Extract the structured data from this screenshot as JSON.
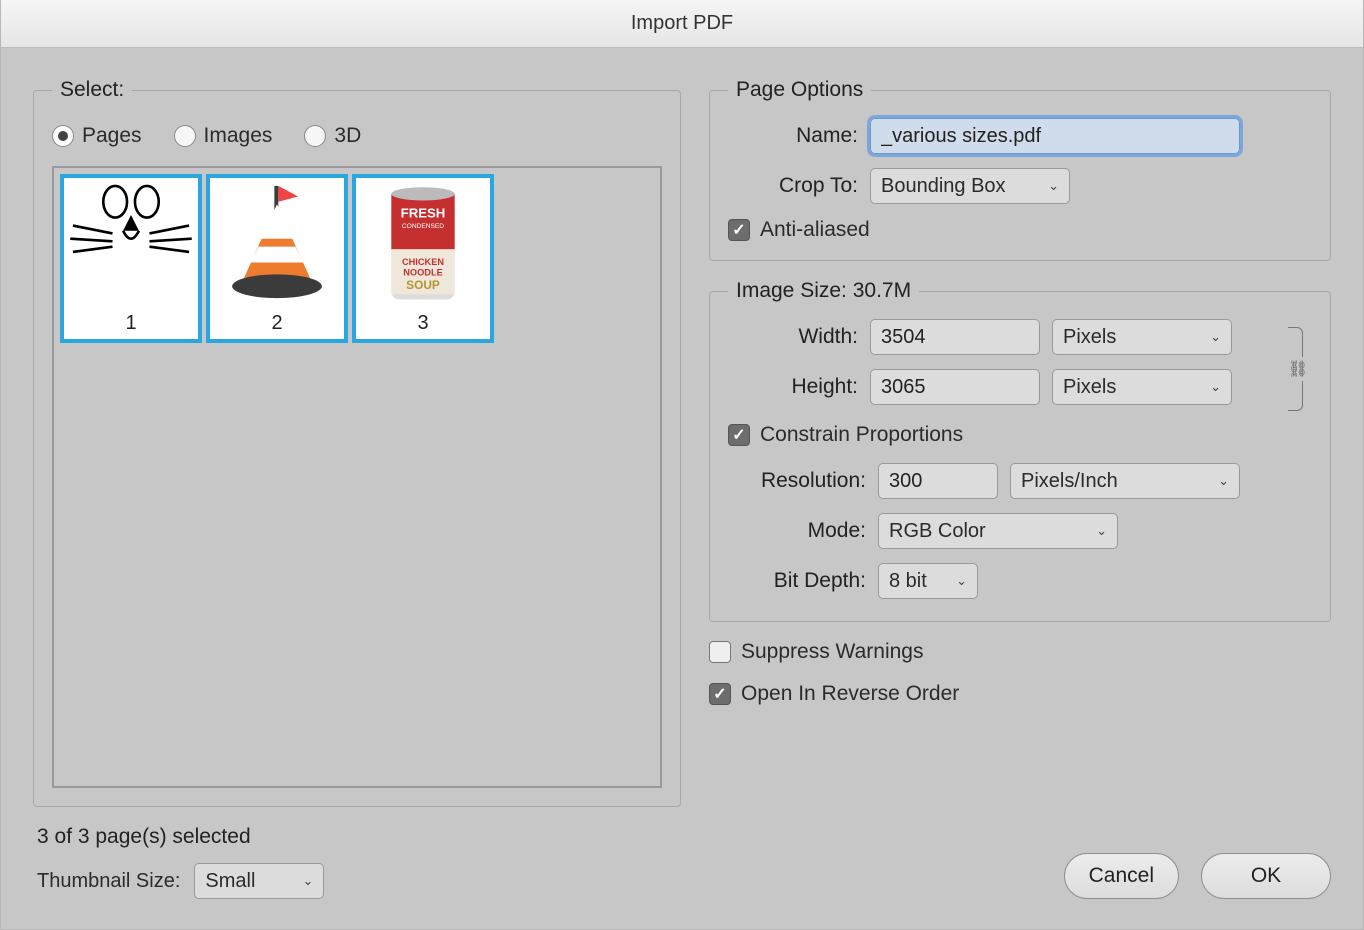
{
  "titlebar": "Import PDF",
  "select": {
    "legend": "Select:",
    "radios": {
      "pages": "Pages",
      "images": "Images",
      "threeD": "3D"
    },
    "selected_radio": "pages",
    "thumbnails": [
      {
        "num": "1"
      },
      {
        "num": "2"
      },
      {
        "num": "3"
      }
    ],
    "status": "3 of 3 page(s) selected",
    "thumb_size_label": "Thumbnail Size:",
    "thumb_size_value": "Small"
  },
  "page_options": {
    "legend": "Page Options",
    "name_label": "Name:",
    "name_value": "_various sizes.pdf",
    "crop_label": "Crop To:",
    "crop_value": "Bounding Box",
    "anti_aliased_label": "Anti-aliased",
    "anti_aliased_checked": true
  },
  "image_size": {
    "legend": "Image Size: 30.7M",
    "width_label": "Width:",
    "width_value": "3504",
    "width_unit": "Pixels",
    "height_label": "Height:",
    "height_value": "3065",
    "height_unit": "Pixels",
    "constrain_label": "Constrain Proportions",
    "constrain_checked": true,
    "resolution_label": "Resolution:",
    "resolution_value": "300",
    "resolution_unit": "Pixels/Inch",
    "mode_label": "Mode:",
    "mode_value": "RGB Color",
    "bitdepth_label": "Bit Depth:",
    "bitdepth_value": "8 bit"
  },
  "bottom_checks": {
    "suppress_label": "Suppress Warnings",
    "suppress_checked": false,
    "reverse_label": "Open In Reverse Order",
    "reverse_checked": true
  },
  "buttons": {
    "cancel": "Cancel",
    "ok": "OK"
  }
}
